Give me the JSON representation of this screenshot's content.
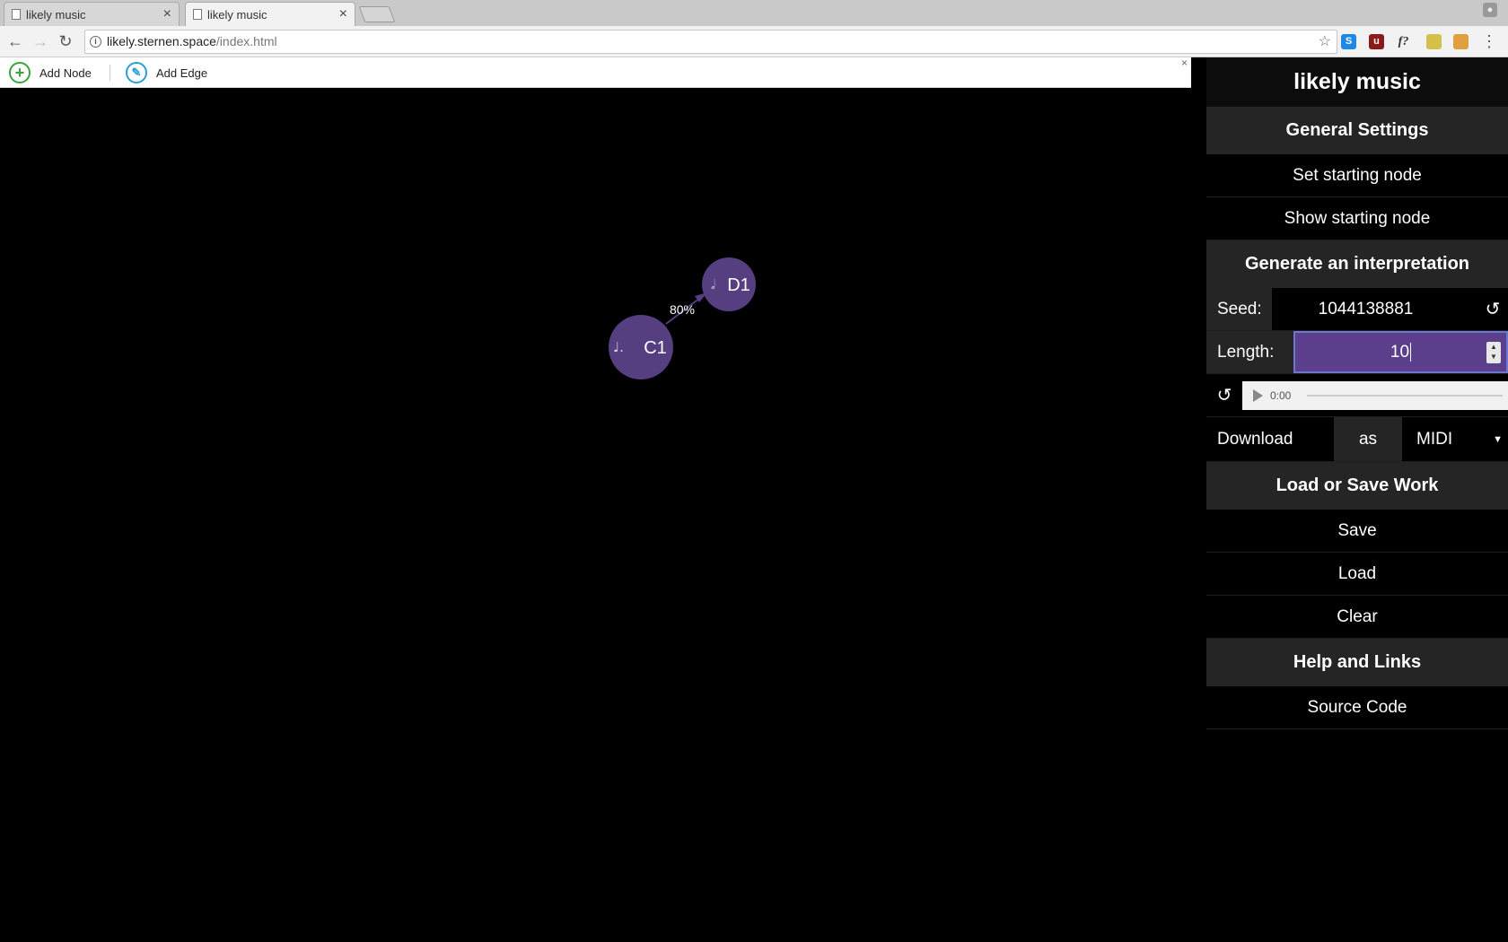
{
  "browser": {
    "tabs": [
      {
        "title": "likely music",
        "active": false
      },
      {
        "title": "likely music",
        "active": true
      }
    ],
    "url_host": "likely.sternen.space",
    "url_path": "/index.html",
    "extensions": [
      {
        "name": "skype-extension",
        "glyph": "S",
        "color": "#1e88e5"
      },
      {
        "name": "ublock-extension",
        "glyph": "u",
        "color": "#8b1a1a"
      },
      {
        "name": "font-extension",
        "glyph": "f?",
        "color": "#555555"
      },
      {
        "name": "hat-extension",
        "glyph": "",
        "color": "#d4c14a"
      },
      {
        "name": "avatar-extension",
        "glyph": "",
        "color": "#e0a040"
      }
    ]
  },
  "app_toolbar": {
    "add_node_label": "Add Node",
    "add_edge_label": "Add Edge",
    "close_glyph": "×"
  },
  "graph": {
    "node_color": "#553f80",
    "nodes": [
      {
        "id": "C1",
        "label": "C1",
        "note": "♩."
      },
      {
        "id": "D1",
        "label": "D1",
        "note": "𝅗𝅥"
      }
    ],
    "edges": [
      {
        "from": "C1",
        "to": "D1",
        "label": "80%"
      }
    ]
  },
  "sidebar": {
    "title": "likely music",
    "general_header": "General Settings",
    "set_start": "Set starting node",
    "show_start": "Show starting node",
    "generate_header": "Generate an interpretation",
    "seed_label": "Seed:",
    "seed_value": "1044138881",
    "reroll_glyph": "↺",
    "length_label": "Length:",
    "length_value": "10",
    "audio_time": "0:00",
    "download_label": "Download",
    "as_label": "as",
    "format_value": "MIDI",
    "load_save_header": "Load or Save Work",
    "save": "Save",
    "load": "Load",
    "clear": "Clear",
    "help_header": "Help and Links",
    "source_code": "Source Code"
  }
}
